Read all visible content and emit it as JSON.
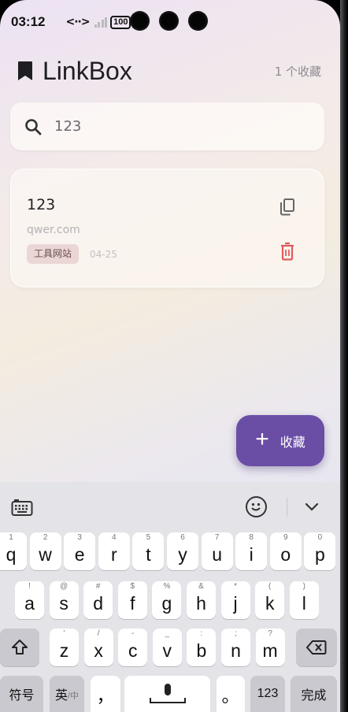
{
  "status": {
    "time": "03:12",
    "signal_text": "<··>",
    "signal_x": "×",
    "battery": "100"
  },
  "header": {
    "title": "LinkBox",
    "count": "1 个收藏"
  },
  "search": {
    "value": "123",
    "placeholder": ""
  },
  "card": {
    "title": "123",
    "url": "qwer.com",
    "tag": "工具网站",
    "date": "04-25"
  },
  "fab": {
    "plus": "+",
    "label": "收藏"
  },
  "colors": {
    "accent": "#6a4ea6",
    "delete": "#e05a5a",
    "tag_bg": "#ead7d5"
  },
  "icons": [
    "bookmark-icon",
    "search-icon",
    "copy-icon",
    "delete-icon",
    "keyboard-icon",
    "emoji-icon",
    "chevron-down-icon",
    "shift-icon",
    "backspace-icon",
    "mic-icon"
  ],
  "keyboard": {
    "row1": [
      {
        "k": "q",
        "h": "1"
      },
      {
        "k": "w",
        "h": "2"
      },
      {
        "k": "e",
        "h": "3"
      },
      {
        "k": "r",
        "h": "4"
      },
      {
        "k": "t",
        "h": "5"
      },
      {
        "k": "y",
        "h": "6"
      },
      {
        "k": "u",
        "h": "7"
      },
      {
        "k": "i",
        "h": "8"
      },
      {
        "k": "o",
        "h": "9"
      },
      {
        "k": "p",
        "h": "0"
      }
    ],
    "row2": [
      {
        "k": "a",
        "h": "!"
      },
      {
        "k": "s",
        "h": "@"
      },
      {
        "k": "d",
        "h": "#"
      },
      {
        "k": "f",
        "h": "$"
      },
      {
        "k": "g",
        "h": "%"
      },
      {
        "k": "h",
        "h": "&"
      },
      {
        "k": "j",
        "h": "*"
      },
      {
        "k": "k",
        "h": "("
      },
      {
        "k": "l",
        "h": ")"
      }
    ],
    "row3": [
      {
        "k": "z",
        "h": "'"
      },
      {
        "k": "x",
        "h": "/"
      },
      {
        "k": "c",
        "h": "-"
      },
      {
        "k": "v",
        "h": "_"
      },
      {
        "k": "b",
        "h": ":"
      },
      {
        "k": "n",
        "h": ";"
      },
      {
        "k": "m",
        "h": "?"
      }
    ],
    "symbols": "符号",
    "lang_main": "英",
    "lang_sub": "/中",
    "comma": "，",
    "period": "。",
    "numbers": "123",
    "done": "完成"
  }
}
